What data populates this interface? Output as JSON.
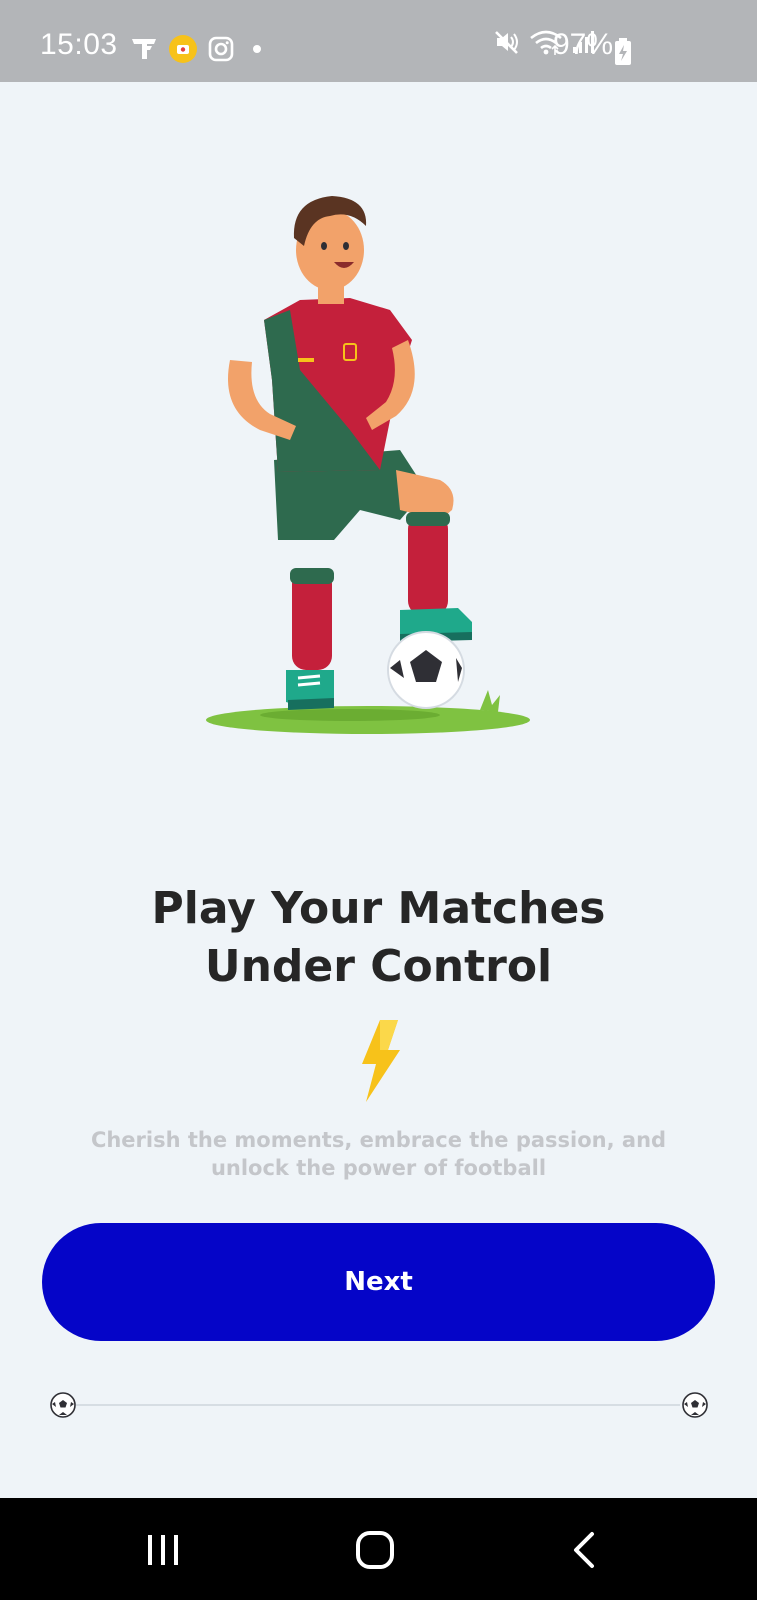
{
  "status_bar": {
    "time": "15:03",
    "battery_percent": "97%",
    "icons": [
      "notification-app-icon",
      "record-icon",
      "instagram-icon",
      "dot-icon",
      "mute-icon",
      "wifi-icon",
      "signal-icon",
      "battery-charging-icon"
    ],
    "background_color": "#b3b5b8"
  },
  "onboarding": {
    "illustration": "football-player-with-ball-illustration",
    "title_line1": "Play Your Matches",
    "title_line2": "Under Control",
    "bolt_icon": "lightning-bolt-icon",
    "subtitle": "Cherish the moments, embrace the passion, and unlock the power of football",
    "next_label": "Next",
    "progress_start_icon": "soccer-ball-icon",
    "progress_end_icon": "soccer-ball-icon"
  },
  "colors": {
    "background": "#eff4f8",
    "primary_button": "#0505c8",
    "title_text": "#262626",
    "subtitle_text": "#c4c6ca",
    "bolt": "#f7c21a"
  },
  "nav_bar": {
    "buttons": [
      "recents-icon",
      "home-icon",
      "back-icon"
    ]
  }
}
